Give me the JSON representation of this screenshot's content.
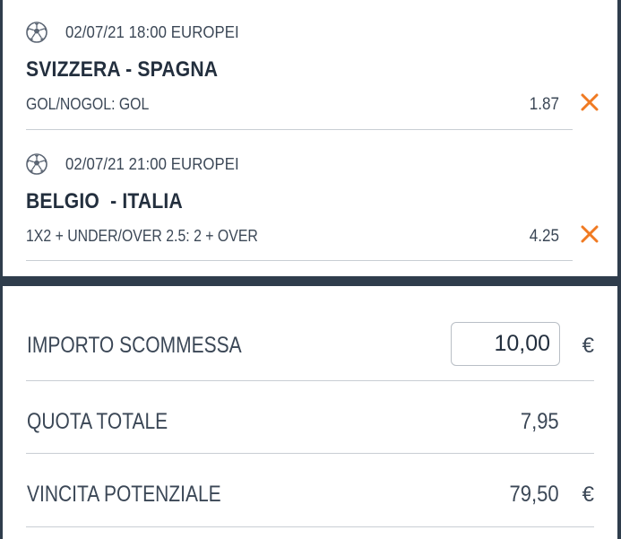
{
  "bets": [
    {
      "icon": "soccer-ball-icon",
      "datetime": "02/07/21 18:00 EUROPEI",
      "match": "SVIZZERA - SPAGNA",
      "market": "GOL/NOGOL: GOL",
      "odd": "1.87",
      "remove_icon": "close-icon"
    },
    {
      "icon": "soccer-ball-icon",
      "datetime": "02/07/21 21:00 EUROPEI",
      "match": "BELGIO  - ITALIA",
      "market": "1X2 + UNDER/OVER 2.5: 2 + OVER",
      "odd": "4.25",
      "remove_icon": "close-icon"
    }
  ],
  "summary": {
    "stake_label": "IMPORTO SCOMMESSA",
    "stake_value": "10,00",
    "currency": "€",
    "total_odds_label": "QUOTA TOTALE",
    "total_odds_value": "7,95",
    "potential_win_label": "VINCITA POTENZIALE",
    "potential_win_value": "79,50"
  },
  "colors": {
    "accent_orange": "#f07a22",
    "text_dark": "#232f3e",
    "background_dark": "#2f3d4c"
  }
}
